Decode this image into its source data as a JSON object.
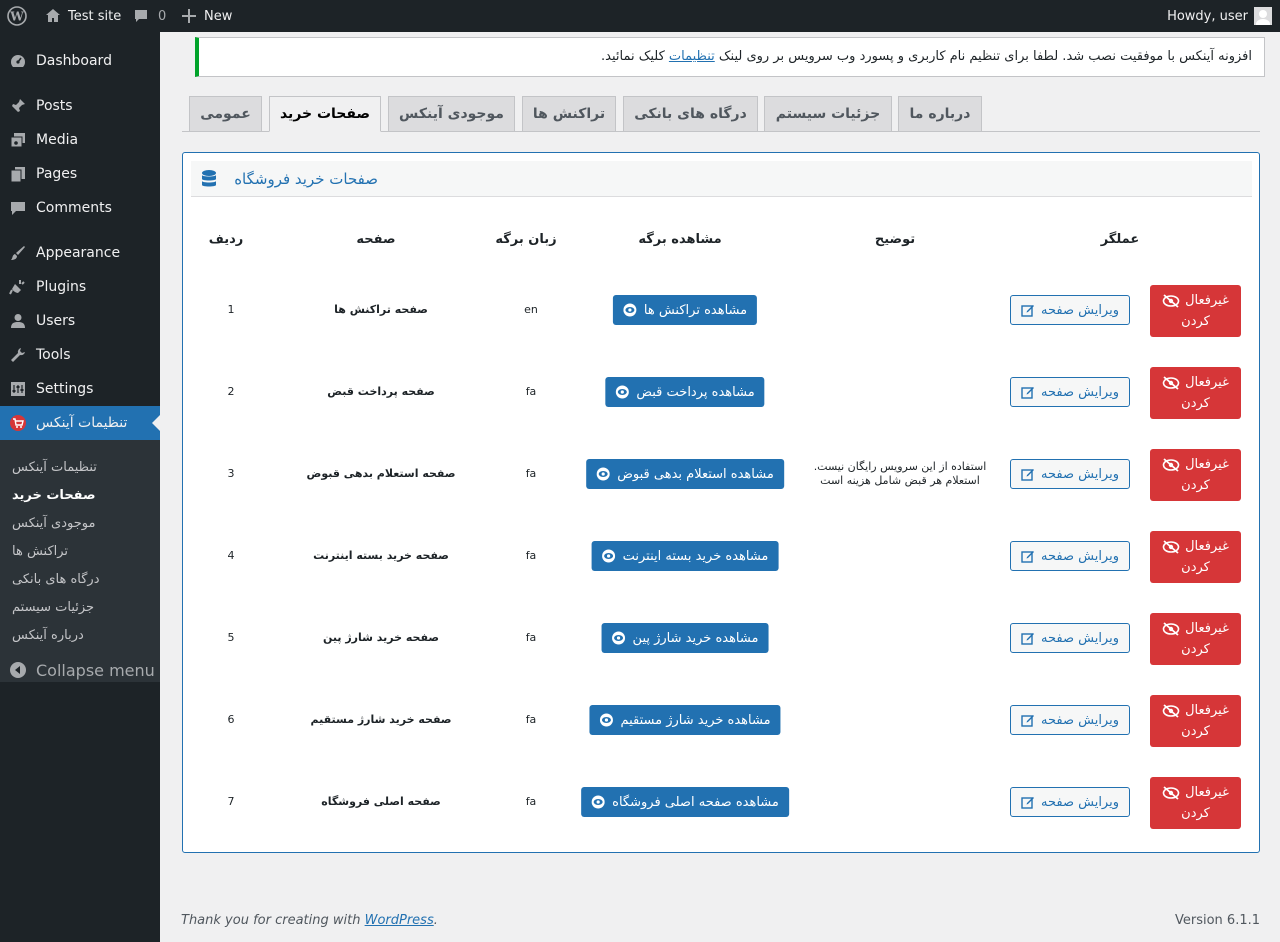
{
  "adminbar": {
    "site_name": "Test site",
    "comments_count": "0",
    "new_label": "New",
    "howdy": "Howdy, user"
  },
  "sidebar": {
    "items": [
      {
        "label": "Dashboard",
        "icon": "dashboard-icon"
      },
      {
        "label": "Posts",
        "icon": "pin-icon"
      },
      {
        "label": "Media",
        "icon": "media-icon"
      },
      {
        "label": "Pages",
        "icon": "pages-icon"
      },
      {
        "label": "Comments",
        "icon": "comment-icon"
      },
      {
        "label": "Appearance",
        "icon": "brush-icon"
      },
      {
        "label": "Plugins",
        "icon": "plug-icon"
      },
      {
        "label": "Users",
        "icon": "user-icon"
      },
      {
        "label": "Tools",
        "icon": "wrench-icon"
      },
      {
        "label": "Settings",
        "icon": "settings-icon"
      },
      {
        "label": "تنظیمات آینکس",
        "icon": "cart-icon"
      }
    ],
    "submenu": [
      "تنظیمات آینکس",
      "صفحات خرید",
      "موجودی آینکس",
      "تراکنش ها",
      "درگاه های بانکی",
      "جزئیات سیستم",
      "درباره آینکس"
    ],
    "collapse_label": "Collapse menu"
  },
  "notice": {
    "before": "افزونه آینکس با موفقیت نصب شد. لطفا برای تنظیم نام کاربری و پسورد وب سرویس بر روی لینک",
    "link": "تنظیمات",
    "after": "کلیک نمائید."
  },
  "tabs": [
    "درباره ما",
    "جزئیات سیستم",
    "درگاه های بانکی",
    "تراکنش ها",
    "موجودی آینکس",
    "صفحات خرید",
    "عمومی"
  ],
  "active_tab": "صفحات خرید",
  "panel_title": "صفحات خرید فروشگاه",
  "table": {
    "headers": {
      "row": "ردیف",
      "page": "صفحه",
      "lang": "زبان برگه",
      "view": "مشاهده برگه",
      "desc": "توضیح",
      "action": "عملگر"
    },
    "edit_label": "ویرایش صفحه",
    "disable_label_1": "غیرفعال",
    "disable_label_2": "کردن",
    "rows": [
      {
        "num": "1",
        "page": "صفحه تراکنش ها",
        "lang": "en",
        "view": "مشاهده تراکنش ها",
        "desc1": "",
        "desc2": ""
      },
      {
        "num": "2",
        "page": "صفحه پرداخت قبض",
        "lang": "fa",
        "view": "مشاهده پرداخت قبض",
        "desc1": "",
        "desc2": ""
      },
      {
        "num": "3",
        "page": "صفحه استعلام بدهی قبوض",
        "lang": "fa",
        "view": "مشاهده استعلام بدهی قبوض",
        "desc1": "استفاده از این سرویس رایگان نیست.",
        "desc2": "استعلام هر قبض شامل هزینه است"
      },
      {
        "num": "4",
        "page": "صفحه خرید بسته اینترنت",
        "lang": "fa",
        "view": "مشاهده خرید بسته اینترنت",
        "desc1": "",
        "desc2": ""
      },
      {
        "num": "5",
        "page": "صفحه خرید شارژ پین",
        "lang": "fa",
        "view": "مشاهده خرید شارژ پین",
        "desc1": "",
        "desc2": ""
      },
      {
        "num": "6",
        "page": "صفحه خرید شارژ مستقیم",
        "lang": "fa",
        "view": "مشاهده خرید شارژ مستقیم",
        "desc1": "",
        "desc2": ""
      },
      {
        "num": "7",
        "page": "صفحه اصلی فروشگاه",
        "lang": "fa",
        "view": "مشاهده صفحه اصلی فروشگاه",
        "desc1": "",
        "desc2": ""
      }
    ]
  },
  "footer": {
    "thanks_before": "Thank you for creating with",
    "wp_link": "WordPress",
    "thanks_after": ".",
    "version": "Version 6.1.1"
  }
}
